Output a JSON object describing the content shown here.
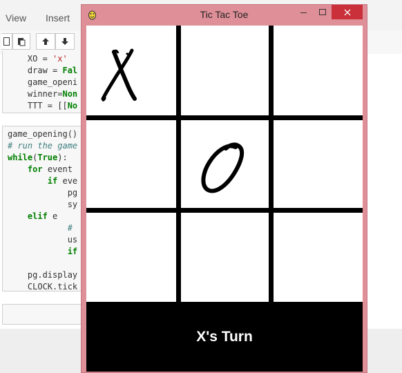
{
  "notebook": {
    "menu": [
      "View",
      "Insert"
    ],
    "toolbar": {
      "icons": [
        "copy-icon",
        "paste-icon",
        "arrow-up-icon",
        "arrow-down-icon"
      ]
    },
    "cell1_lines": [
      [
        "    XO = ",
        "'x'"
      ],
      [
        "    draw = ",
        "Fal"
      ],
      [
        "    game_openi",
        ""
      ],
      [
        "    winner=",
        "Non"
      ],
      [
        "    TTT = [[",
        "No"
      ]
    ],
    "cell2_lines": [
      "game_opening()",
      "# run the game",
      "while(True):",
      "    for event",
      "        if eve",
      "            pg",
      "            sy",
      "    elif e",
      "            #",
      "            us",
      "            if",
      "",
      "    pg.display",
      "    CLOCK.tick"
    ]
  },
  "window": {
    "title": "Tic Tac Toe",
    "controls": [
      "minimize",
      "maximize",
      "close"
    ]
  },
  "game": {
    "board": [
      [
        "X",
        "",
        ""
      ],
      [
        "",
        "O",
        ""
      ],
      [
        "",
        "",
        ""
      ]
    ],
    "status": "X's Turn"
  },
  "colors": {
    "window_frame": "#df8f97",
    "close_button": "#c9303a",
    "board_lines": "#000000"
  }
}
